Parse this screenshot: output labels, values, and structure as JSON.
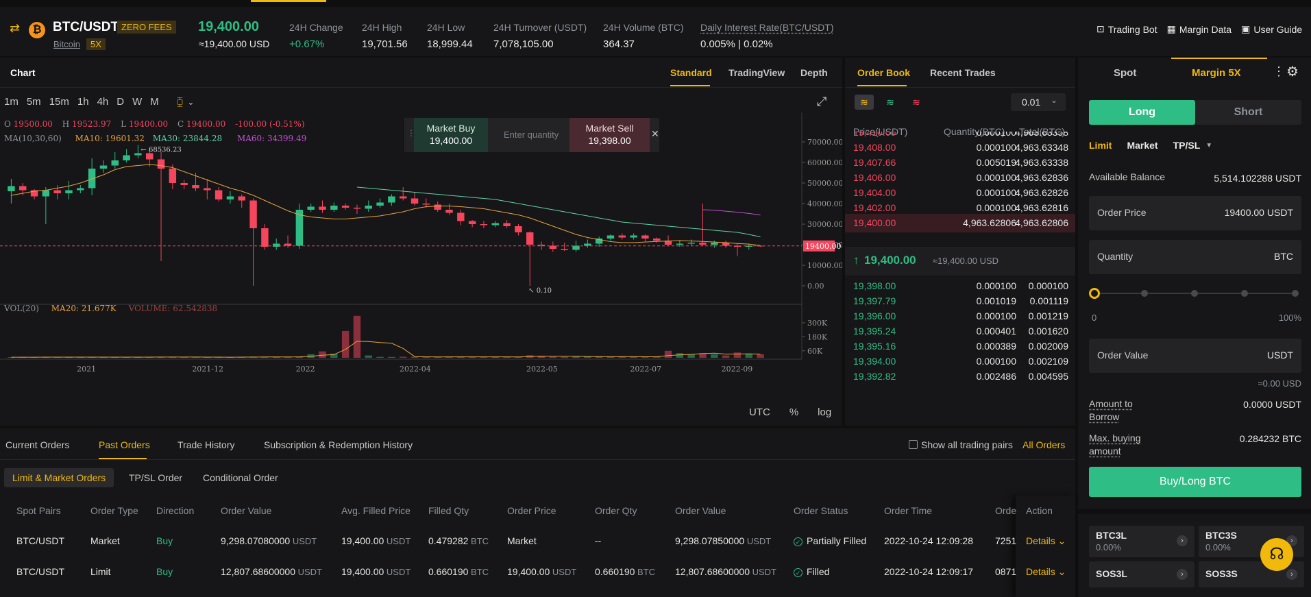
{
  "header": {
    "pair": "BTC/USDT",
    "zero_fees": "ZERO FEES",
    "coin_name": "Bitcoin",
    "leverage": "5X",
    "last_price": "19,400.00",
    "last_price_usd": "≈19,400.00 USD",
    "stats": [
      {
        "label": "24H Change",
        "value": "+0.67%"
      },
      {
        "label": "24H High",
        "value": "19,701.56"
      },
      {
        "label": "24H Low",
        "value": "18,999.44"
      },
      {
        "label": "24H Turnover (USDT)",
        "value": "7,078,105.00"
      },
      {
        "label": "24H Volume (BTC)",
        "value": "364.37"
      },
      {
        "label": "Daily Interest Rate(BTC/USDT)",
        "value": "0.005% | 0.02%"
      }
    ],
    "links": [
      "Trading Bot",
      "Margin Data",
      "User Guide"
    ]
  },
  "chart_panel": {
    "title": "Chart",
    "view_tabs": [
      "Standard",
      "TradingView",
      "Depth"
    ],
    "active_view": "Standard",
    "timeframes": [
      "1m",
      "5m",
      "15m",
      "1h",
      "4h",
      "D",
      "W",
      "M"
    ],
    "active_timeframe": "W",
    "quick_order": {
      "buy_label": "Market Buy",
      "buy_price": "19,400.00",
      "placeholder": "Enter quantity",
      "sell_label": "Market Sell",
      "sell_price": "19,398.00"
    },
    "footer": [
      "UTC",
      "%",
      "log"
    ]
  },
  "chart_data": {
    "type": "candlestick",
    "legend_ohlc": {
      "O": "19500.00",
      "H": "19523.97",
      "L": "19400.00",
      "C": "19400.00",
      "change": "-100.00 (-0.51%)"
    },
    "ma_legend": {
      "label": "MA(10,30,60)",
      "ma10": "MA10: 19601.32",
      "ma30": "MA30: 23844.28",
      "ma60": "MA60: 34399.49"
    },
    "high_marker": "68536.23",
    "low_marker": "0.10",
    "current_price_tag": "19400.00",
    "y_ticks": [
      "70000.00",
      "60000.00",
      "50000.00",
      "40000.00",
      "30000.00",
      "20000.00",
      "10000.00",
      "0.00"
    ],
    "x_ticks": [
      "2021",
      "2021-12",
      "2022",
      "2022-04",
      "2022-05",
      "2022-07",
      "2022-09"
    ],
    "volume_legend": {
      "label": "VOL(20)",
      "ma20": "MA20: 21.677K",
      "volume": "VOLUME: 62.542838"
    },
    "volume_ticks": [
      "300K",
      "180K",
      "60K"
    ],
    "candles": [
      {
        "o": 46000,
        "c": 48500,
        "h": 52000,
        "l": 40000
      },
      {
        "o": 48500,
        "c": 46500,
        "h": 50000,
        "l": 44000
      },
      {
        "o": 46500,
        "c": 43500,
        "h": 47000,
        "l": 42000
      },
      {
        "o": 43500,
        "c": 46500,
        "h": 48000,
        "l": 30000
      },
      {
        "o": 46500,
        "c": 45000,
        "h": 49000,
        "l": 42000
      },
      {
        "o": 45000,
        "c": 46500,
        "h": 51000,
        "l": 42000
      },
      {
        "o": 46500,
        "c": 47500,
        "h": 49000,
        "l": 45000
      },
      {
        "o": 47500,
        "c": 57000,
        "h": 62000,
        "l": 44000
      },
      {
        "o": 57000,
        "c": 58500,
        "h": 61000,
        "l": 55000
      },
      {
        "o": 58500,
        "c": 61000,
        "h": 65000,
        "l": 57000
      },
      {
        "o": 61000,
        "c": 63500,
        "h": 66500,
        "l": 60000
      },
      {
        "o": 63500,
        "c": 64500,
        "h": 68500,
        "l": 62000
      },
      {
        "o": 64500,
        "c": 61500,
        "h": 66000,
        "l": 58000
      },
      {
        "o": 61500,
        "c": 57000,
        "h": 65000,
        "l": 12000
      },
      {
        "o": 57000,
        "c": 50000,
        "h": 59000,
        "l": 47000
      },
      {
        "o": 50000,
        "c": 49000,
        "h": 51500,
        "l": 47000
      },
      {
        "o": 49000,
        "c": 47500,
        "h": 55000,
        "l": 46000
      },
      {
        "o": 47500,
        "c": 46500,
        "h": 52000,
        "l": 42000
      },
      {
        "o": 46500,
        "c": 42000,
        "h": 48000,
        "l": 41000
      },
      {
        "o": 42000,
        "c": 43500,
        "h": 46000,
        "l": 40000
      },
      {
        "o": 43500,
        "c": 41500,
        "h": 44500,
        "l": 38000
      },
      {
        "o": 41500,
        "c": 28000,
        "h": 42500,
        "l": 0.1
      },
      {
        "o": 28000,
        "c": 19000,
        "h": 30000,
        "l": 17500
      },
      {
        "o": 19000,
        "c": 20500,
        "h": 23000,
        "l": 17500
      },
      {
        "o": 20500,
        "c": 19500,
        "h": 24500,
        "l": 18500
      },
      {
        "o": 19500,
        "c": 37000,
        "h": 40000,
        "l": 18000
      },
      {
        "o": 37000,
        "c": 38500,
        "h": 40000,
        "l": 36000
      },
      {
        "o": 38500,
        "c": 37000,
        "h": 41500,
        "l": 35500
      },
      {
        "o": 37000,
        "c": 39000,
        "h": 40500,
        "l": 36000
      },
      {
        "o": 39000,
        "c": 38000,
        "h": 40000,
        "l": 37000
      },
      {
        "o": 38000,
        "c": 37500,
        "h": 39500,
        "l": 35000
      },
      {
        "o": 37500,
        "c": 39000,
        "h": 41500,
        "l": 36000
      },
      {
        "o": 39000,
        "c": 40500,
        "h": 42500,
        "l": 38000
      },
      {
        "o": 40500,
        "c": 43500,
        "h": 44500,
        "l": 39000
      },
      {
        "o": 43500,
        "c": 42500,
        "h": 48000,
        "l": 41500
      },
      {
        "o": 42500,
        "c": 40000,
        "h": 45500,
        "l": 39000
      },
      {
        "o": 40000,
        "c": 39500,
        "h": 42500,
        "l": 38000
      },
      {
        "o": 39500,
        "c": 37000,
        "h": 41000,
        "l": 36000
      },
      {
        "o": 37000,
        "c": 35500,
        "h": 40000,
        "l": 34500
      },
      {
        "o": 35500,
        "c": 31500,
        "h": 37000,
        "l": 29500
      },
      {
        "o": 31500,
        "c": 30000,
        "h": 32000,
        "l": 28500
      },
      {
        "o": 30000,
        "c": 29500,
        "h": 31500,
        "l": 28000
      },
      {
        "o": 29500,
        "c": 30500,
        "h": 31500,
        "l": 28500
      },
      {
        "o": 30500,
        "c": 29000,
        "h": 32000,
        "l": 28000
      },
      {
        "o": 29000,
        "c": 26000,
        "h": 30000,
        "l": 24500
      },
      {
        "o": 26000,
        "c": 20000,
        "h": 26500,
        "l": 0
      },
      {
        "o": 20000,
        "c": 19500,
        "h": 21500,
        "l": 17500
      },
      {
        "o": 19500,
        "c": 18000,
        "h": 21500,
        "l": 16500
      },
      {
        "o": 18000,
        "c": 17500,
        "h": 21000,
        "l": 17000
      },
      {
        "o": 17500,
        "c": 19500,
        "h": 22000,
        "l": 16500
      },
      {
        "o": 19500,
        "c": 20500,
        "h": 22500,
        "l": 18500
      },
      {
        "o": 20500,
        "c": 23000,
        "h": 24000,
        "l": 19000
      },
      {
        "o": 23000,
        "c": 24500,
        "h": 25000,
        "l": 22000
      },
      {
        "o": 24500,
        "c": 23500,
        "h": 25500,
        "l": 22500
      },
      {
        "o": 23500,
        "c": 24500,
        "h": 25500,
        "l": 22500
      },
      {
        "o": 24500,
        "c": 23000,
        "h": 25000,
        "l": 21500
      },
      {
        "o": 23000,
        "c": 22000,
        "h": 23500,
        "l": 21000
      },
      {
        "o": 22000,
        "c": 20000,
        "h": 24500,
        "l": 19500
      },
      {
        "o": 20000,
        "c": 20500,
        "h": 22000,
        "l": 19000
      },
      {
        "o": 20500,
        "c": 21000,
        "h": 22500,
        "l": 19500
      },
      {
        "o": 21000,
        "c": 20000,
        "h": 40000,
        "l": 19500
      },
      {
        "o": 20000,
        "c": 21000,
        "h": 22000,
        "l": 18500
      },
      {
        "o": 21000,
        "c": 19500,
        "h": 22000,
        "l": 18500
      },
      {
        "o": 19500,
        "c": 19000,
        "h": 20500,
        "l": 14500
      },
      {
        "o": 19000,
        "c": 19500,
        "h": 20500,
        "l": 17500
      },
      {
        "o": 19500,
        "c": 19400,
        "h": 19600,
        "l": 19000
      }
    ],
    "volumes": [
      5,
      6,
      5,
      7,
      5,
      5,
      6,
      7,
      6,
      5,
      6,
      6,
      7,
      8,
      6,
      5,
      5,
      6,
      6,
      5,
      6,
      9,
      8,
      6,
      7,
      10,
      30,
      55,
      35,
      230,
      360,
      20,
      8,
      7,
      9,
      8,
      8,
      7,
      9,
      10,
      8,
      7,
      8,
      7,
      9,
      22,
      18,
      9,
      8,
      10,
      12,
      10,
      8,
      9,
      8,
      9,
      10,
      60,
      40,
      28,
      40,
      30,
      20,
      45,
      34,
      30
    ],
    "ma10_line": [
      44000,
      45000,
      46000,
      46500,
      47500,
      48500,
      50000,
      52000,
      54000,
      56500,
      58000,
      58500,
      59000,
      58500,
      57500,
      55500,
      53500,
      51500,
      49500,
      47500,
      46000,
      44000,
      41500,
      39000,
      36500,
      34500,
      33500,
      33000,
      32500,
      32500,
      33000,
      33500,
      34000,
      35000,
      36000,
      37500,
      38500,
      38800,
      38800,
      38500,
      38000,
      37500,
      36500,
      35500,
      34500,
      33000,
      31000,
      29000,
      27000,
      25000,
      23500,
      22500,
      21500,
      21000,
      21000,
      21300,
      21600,
      21800,
      22000,
      21800,
      21600,
      21300,
      21000,
      20600,
      20300,
      19600
    ],
    "ma30_line": [
      null,
      null,
      null,
      null,
      null,
      null,
      null,
      null,
      null,
      null,
      null,
      null,
      null,
      null,
      null,
      null,
      null,
      null,
      null,
      null,
      null,
      null,
      null,
      null,
      null,
      null,
      null,
      null,
      null,
      null,
      48000,
      47500,
      47000,
      46500,
      46000,
      45500,
      45000,
      44500,
      44000,
      43500,
      43000,
      42500,
      42000,
      41000,
      40000,
      39000,
      38000,
      37000,
      36000,
      35000,
      34000,
      33000,
      32000,
      31000,
      30500,
      30000,
      29500,
      29000,
      28500,
      28000,
      27500,
      27000,
      26500,
      26000,
      25000,
      23800
    ],
    "ma60_line": [
      null,
      null,
      null,
      null,
      null,
      null,
      null,
      null,
      null,
      null,
      null,
      null,
      null,
      null,
      null,
      null,
      null,
      null,
      null,
      null,
      null,
      null,
      null,
      null,
      null,
      null,
      null,
      null,
      null,
      null,
      null,
      null,
      null,
      null,
      null,
      null,
      null,
      null,
      null,
      null,
      null,
      null,
      null,
      null,
      null,
      null,
      null,
      null,
      null,
      null,
      null,
      null,
      null,
      null,
      null,
      null,
      null,
      null,
      null,
      null,
      37000,
      36800,
      36300,
      35800,
      35200,
      34400
    ]
  },
  "orderbook": {
    "tabs": [
      "Order Book",
      "Recent Trades"
    ],
    "precision": "0.01",
    "headers": [
      "Price(USDT)",
      "Quantity(BTC)",
      "Total(BTC)"
    ],
    "asks": [
      [
        "19,410.00",
        "0.000100",
        "4,963.63358"
      ],
      [
        "19,408.00",
        "0.000100",
        "4,963.63348"
      ],
      [
        "19,407.66",
        "0.005019",
        "4,963.63338"
      ],
      [
        "19,406.00",
        "0.000100",
        "4,963.62836"
      ],
      [
        "19,404.00",
        "0.000100",
        "4,963.62826"
      ],
      [
        "19,402.00",
        "0.000100",
        "4,963.62816"
      ],
      [
        "19,400.00",
        "4,963.62806",
        "4,963.62806"
      ]
    ],
    "mid_price": "19,400.00",
    "mid_usd": "≈19,400.00 USD",
    "bids": [
      [
        "19,398.00",
        "0.000100",
        "0.000100"
      ],
      [
        "19,397.79",
        "0.001019",
        "0.001119"
      ],
      [
        "19,396.00",
        "0.000100",
        "0.001219"
      ],
      [
        "19,395.24",
        "0.000401",
        "0.001620"
      ],
      [
        "19,395.16",
        "0.000389",
        "0.002009"
      ],
      [
        "19,394.00",
        "0.000100",
        "0.002109"
      ],
      [
        "19,392.82",
        "0.002486",
        "0.004595"
      ]
    ]
  },
  "trade": {
    "tabs": [
      "Spot",
      "Margin 5X"
    ],
    "long": "Long",
    "short": "Short",
    "order_types": [
      "Limit",
      "Market",
      "TP/SL"
    ],
    "available_label": "Available Balance",
    "available_value": "5,514.102288 USDT",
    "order_price_label": "Order Price",
    "order_price_value": "19400.00",
    "order_price_unit": "USDT",
    "quantity_label": "Quantity",
    "quantity_unit": "BTC",
    "slider_min": "0",
    "slider_max": "100%",
    "slider_level": 0,
    "order_value_label": "Order Value",
    "order_value_unit": "USDT",
    "order_value_usd": "≈0.00 USD",
    "borrow_label_1": "Amount to",
    "borrow_label_2": "Borrow",
    "borrow_value": "0.0000 USDT",
    "maxbuy_label_1": "Max. buying",
    "maxbuy_label_2": "amount",
    "maxbuy_value": "0.284232 BTC",
    "submit": "Buy/Long BTC",
    "etfs": [
      {
        "name": "BTC3L",
        "change": "0.00%"
      },
      {
        "name": "BTC3S",
        "change": "0.00%"
      },
      {
        "name": "SOS3L",
        "change": ""
      },
      {
        "name": "SOS3S",
        "change": ""
      }
    ]
  },
  "orders": {
    "tabs": [
      "Current Orders",
      "Past Orders",
      "Trade History",
      "Subscription & Redemption History"
    ],
    "active_tab": "Past Orders",
    "show_all": "Show all trading pairs",
    "all_orders": "All Orders",
    "subtabs": [
      "Limit & Market Orders",
      "TP/SL Order",
      "Conditional Order"
    ],
    "columns": [
      "Spot Pairs",
      "Order Type",
      "Direction",
      "Order Value",
      "Avg. Filled Price",
      "Filled Qty",
      "Order Price",
      "Order Qty",
      "Order Value",
      "Order Status",
      "Order Time",
      "Orde",
      "Action"
    ],
    "rows": [
      {
        "pair": "BTC/USDT",
        "type": "Market",
        "dir": "Buy",
        "value": "9,298.07080000",
        "value_unit": "USDT",
        "avg": "19,400.00",
        "avg_unit": "USDT",
        "qty": "0.479282",
        "qty_unit": "BTC",
        "price": "Market",
        "price_unit": "",
        "oqty": "--",
        "oqty_unit": "",
        "ovalue": "9,298.07850000",
        "ovalue_unit": "USDT",
        "status": "Partially Filled",
        "time": "2022-10-24 12:09:28",
        "id": "7251",
        "action": "Details"
      },
      {
        "pair": "BTC/USDT",
        "type": "Limit",
        "dir": "Buy",
        "value": "12,807.68600000",
        "value_unit": "USDT",
        "avg": "19,400.00",
        "avg_unit": "USDT",
        "qty": "0.660190",
        "qty_unit": "BTC",
        "price": "19,400.00",
        "price_unit": "USDT",
        "oqty": "0.660190",
        "oqty_unit": "BTC",
        "ovalue": "12,807.68600000",
        "ovalue_unit": "USDT",
        "status": "Filled",
        "time": "2022-10-24 12:09:17",
        "id": "0871",
        "action": "Details"
      }
    ]
  },
  "colors": {
    "up": "#2ebd85",
    "down": "#f6465d",
    "accent": "#f0b90b",
    "panel": "#161618",
    "bg": "#0f0f10"
  }
}
